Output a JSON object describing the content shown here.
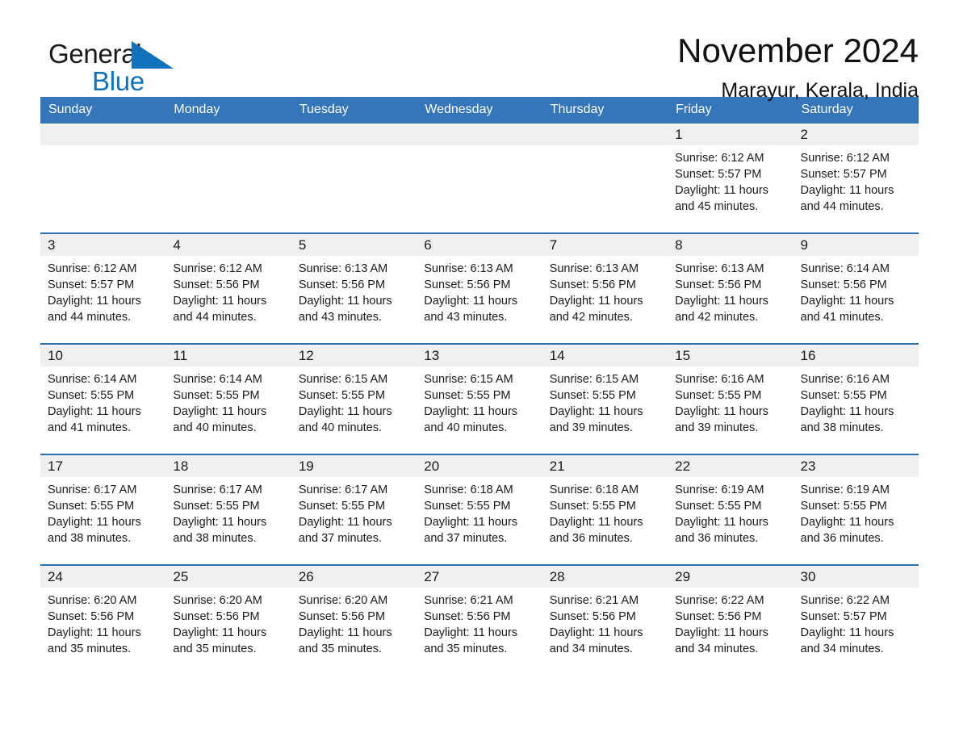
{
  "brand": {
    "name_part1": "General",
    "name_part2": "Blue",
    "triangle_color": "#1072bb",
    "accent_color": "#3576ba"
  },
  "header": {
    "title": "November 2024",
    "subtitle": "Marayur, Kerala, India"
  },
  "calendar": {
    "weekday_headers": [
      "Sunday",
      "Monday",
      "Tuesday",
      "Wednesday",
      "Thursday",
      "Friday",
      "Saturday"
    ],
    "header_bg": "#3576ba",
    "row_border_color": "#2f6fb0",
    "daynum_bg": "#f0f0f0",
    "weeks": [
      [
        {
          "day": "",
          "sunrise": "",
          "sunset": "",
          "daylight_line1": "",
          "daylight_line2": ""
        },
        {
          "day": "",
          "sunrise": "",
          "sunset": "",
          "daylight_line1": "",
          "daylight_line2": ""
        },
        {
          "day": "",
          "sunrise": "",
          "sunset": "",
          "daylight_line1": "",
          "daylight_line2": ""
        },
        {
          "day": "",
          "sunrise": "",
          "sunset": "",
          "daylight_line1": "",
          "daylight_line2": ""
        },
        {
          "day": "",
          "sunrise": "",
          "sunset": "",
          "daylight_line1": "",
          "daylight_line2": ""
        },
        {
          "day": "1",
          "sunrise": "Sunrise: 6:12 AM",
          "sunset": "Sunset: 5:57 PM",
          "daylight_line1": "Daylight: 11 hours",
          "daylight_line2": "and 45 minutes."
        },
        {
          "day": "2",
          "sunrise": "Sunrise: 6:12 AM",
          "sunset": "Sunset: 5:57 PM",
          "daylight_line1": "Daylight: 11 hours",
          "daylight_line2": "and 44 minutes."
        }
      ],
      [
        {
          "day": "3",
          "sunrise": "Sunrise: 6:12 AM",
          "sunset": "Sunset: 5:57 PM",
          "daylight_line1": "Daylight: 11 hours",
          "daylight_line2": "and 44 minutes."
        },
        {
          "day": "4",
          "sunrise": "Sunrise: 6:12 AM",
          "sunset": "Sunset: 5:56 PM",
          "daylight_line1": "Daylight: 11 hours",
          "daylight_line2": "and 44 minutes."
        },
        {
          "day": "5",
          "sunrise": "Sunrise: 6:13 AM",
          "sunset": "Sunset: 5:56 PM",
          "daylight_line1": "Daylight: 11 hours",
          "daylight_line2": "and 43 minutes."
        },
        {
          "day": "6",
          "sunrise": "Sunrise: 6:13 AM",
          "sunset": "Sunset: 5:56 PM",
          "daylight_line1": "Daylight: 11 hours",
          "daylight_line2": "and 43 minutes."
        },
        {
          "day": "7",
          "sunrise": "Sunrise: 6:13 AM",
          "sunset": "Sunset: 5:56 PM",
          "daylight_line1": "Daylight: 11 hours",
          "daylight_line2": "and 42 minutes."
        },
        {
          "day": "8",
          "sunrise": "Sunrise: 6:13 AM",
          "sunset": "Sunset: 5:56 PM",
          "daylight_line1": "Daylight: 11 hours",
          "daylight_line2": "and 42 minutes."
        },
        {
          "day": "9",
          "sunrise": "Sunrise: 6:14 AM",
          "sunset": "Sunset: 5:56 PM",
          "daylight_line1": "Daylight: 11 hours",
          "daylight_line2": "and 41 minutes."
        }
      ],
      [
        {
          "day": "10",
          "sunrise": "Sunrise: 6:14 AM",
          "sunset": "Sunset: 5:55 PM",
          "daylight_line1": "Daylight: 11 hours",
          "daylight_line2": "and 41 minutes."
        },
        {
          "day": "11",
          "sunrise": "Sunrise: 6:14 AM",
          "sunset": "Sunset: 5:55 PM",
          "daylight_line1": "Daylight: 11 hours",
          "daylight_line2": "and 40 minutes."
        },
        {
          "day": "12",
          "sunrise": "Sunrise: 6:15 AM",
          "sunset": "Sunset: 5:55 PM",
          "daylight_line1": "Daylight: 11 hours",
          "daylight_line2": "and 40 minutes."
        },
        {
          "day": "13",
          "sunrise": "Sunrise: 6:15 AM",
          "sunset": "Sunset: 5:55 PM",
          "daylight_line1": "Daylight: 11 hours",
          "daylight_line2": "and 40 minutes."
        },
        {
          "day": "14",
          "sunrise": "Sunrise: 6:15 AM",
          "sunset": "Sunset: 5:55 PM",
          "daylight_line1": "Daylight: 11 hours",
          "daylight_line2": "and 39 minutes."
        },
        {
          "day": "15",
          "sunrise": "Sunrise: 6:16 AM",
          "sunset": "Sunset: 5:55 PM",
          "daylight_line1": "Daylight: 11 hours",
          "daylight_line2": "and 39 minutes."
        },
        {
          "day": "16",
          "sunrise": "Sunrise: 6:16 AM",
          "sunset": "Sunset: 5:55 PM",
          "daylight_line1": "Daylight: 11 hours",
          "daylight_line2": "and 38 minutes."
        }
      ],
      [
        {
          "day": "17",
          "sunrise": "Sunrise: 6:17 AM",
          "sunset": "Sunset: 5:55 PM",
          "daylight_line1": "Daylight: 11 hours",
          "daylight_line2": "and 38 minutes."
        },
        {
          "day": "18",
          "sunrise": "Sunrise: 6:17 AM",
          "sunset": "Sunset: 5:55 PM",
          "daylight_line1": "Daylight: 11 hours",
          "daylight_line2": "and 38 minutes."
        },
        {
          "day": "19",
          "sunrise": "Sunrise: 6:17 AM",
          "sunset": "Sunset: 5:55 PM",
          "daylight_line1": "Daylight: 11 hours",
          "daylight_line2": "and 37 minutes."
        },
        {
          "day": "20",
          "sunrise": "Sunrise: 6:18 AM",
          "sunset": "Sunset: 5:55 PM",
          "daylight_line1": "Daylight: 11 hours",
          "daylight_line2": "and 37 minutes."
        },
        {
          "day": "21",
          "sunrise": "Sunrise: 6:18 AM",
          "sunset": "Sunset: 5:55 PM",
          "daylight_line1": "Daylight: 11 hours",
          "daylight_line2": "and 36 minutes."
        },
        {
          "day": "22",
          "sunrise": "Sunrise: 6:19 AM",
          "sunset": "Sunset: 5:55 PM",
          "daylight_line1": "Daylight: 11 hours",
          "daylight_line2": "and 36 minutes."
        },
        {
          "day": "23",
          "sunrise": "Sunrise: 6:19 AM",
          "sunset": "Sunset: 5:55 PM",
          "daylight_line1": "Daylight: 11 hours",
          "daylight_line2": "and 36 minutes."
        }
      ],
      [
        {
          "day": "24",
          "sunrise": "Sunrise: 6:20 AM",
          "sunset": "Sunset: 5:56 PM",
          "daylight_line1": "Daylight: 11 hours",
          "daylight_line2": "and 35 minutes."
        },
        {
          "day": "25",
          "sunrise": "Sunrise: 6:20 AM",
          "sunset": "Sunset: 5:56 PM",
          "daylight_line1": "Daylight: 11 hours",
          "daylight_line2": "and 35 minutes."
        },
        {
          "day": "26",
          "sunrise": "Sunrise: 6:20 AM",
          "sunset": "Sunset: 5:56 PM",
          "daylight_line1": "Daylight: 11 hours",
          "daylight_line2": "and 35 minutes."
        },
        {
          "day": "27",
          "sunrise": "Sunrise: 6:21 AM",
          "sunset": "Sunset: 5:56 PM",
          "daylight_line1": "Daylight: 11 hours",
          "daylight_line2": "and 35 minutes."
        },
        {
          "day": "28",
          "sunrise": "Sunrise: 6:21 AM",
          "sunset": "Sunset: 5:56 PM",
          "daylight_line1": "Daylight: 11 hours",
          "daylight_line2": "and 34 minutes."
        },
        {
          "day": "29",
          "sunrise": "Sunrise: 6:22 AM",
          "sunset": "Sunset: 5:56 PM",
          "daylight_line1": "Daylight: 11 hours",
          "daylight_line2": "and 34 minutes."
        },
        {
          "day": "30",
          "sunrise": "Sunrise: 6:22 AM",
          "sunset": "Sunset: 5:57 PM",
          "daylight_line1": "Daylight: 11 hours",
          "daylight_line2": "and 34 minutes."
        }
      ]
    ]
  }
}
